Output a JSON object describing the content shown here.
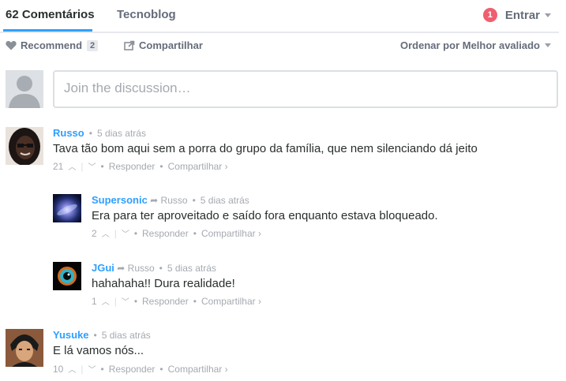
{
  "nav": {
    "tab_active": "62 Comentários",
    "tab_site": "Tecnoblog",
    "notif_count": "1",
    "login_label": "Entrar"
  },
  "toolbar": {
    "recommend_label": "Recommend",
    "recommend_count": "2",
    "share_label": "Compartilhar",
    "sort_label": "Ordenar por Melhor avaliado"
  },
  "composer": {
    "placeholder": "Join the discussion…"
  },
  "comments": [
    {
      "author": "Russo",
      "time": "5 dias atrás",
      "text": "Tava tão bom aqui sem a porra do grupo da família, que nem silenciando dá jeito",
      "votes": "21",
      "reply_label": "Responder",
      "share_label": "Compartilhar ›"
    },
    {
      "author": "Supersonic",
      "in_reply_to": "Russo",
      "time": "5 dias atrás",
      "text": "Era para ter aproveitado e saído fora enquanto estava bloqueado.",
      "votes": "2",
      "reply_label": "Responder",
      "share_label": "Compartilhar ›"
    },
    {
      "author": "JGui",
      "in_reply_to": "Russo",
      "time": "5 dias atrás",
      "text": "hahahaha!! Dura realidade!",
      "votes": "1",
      "reply_label": "Responder",
      "share_label": "Compartilhar ›"
    },
    {
      "author": "Yusuke",
      "time": "5 dias atrás",
      "text": "E lá vamos nós...",
      "votes": "10",
      "reply_label": "Responder",
      "share_label": "Compartilhar ›"
    }
  ],
  "colors": {
    "accent": "#2e9fff",
    "badge": "#f05f70",
    "muted": "#a5a9b0"
  }
}
